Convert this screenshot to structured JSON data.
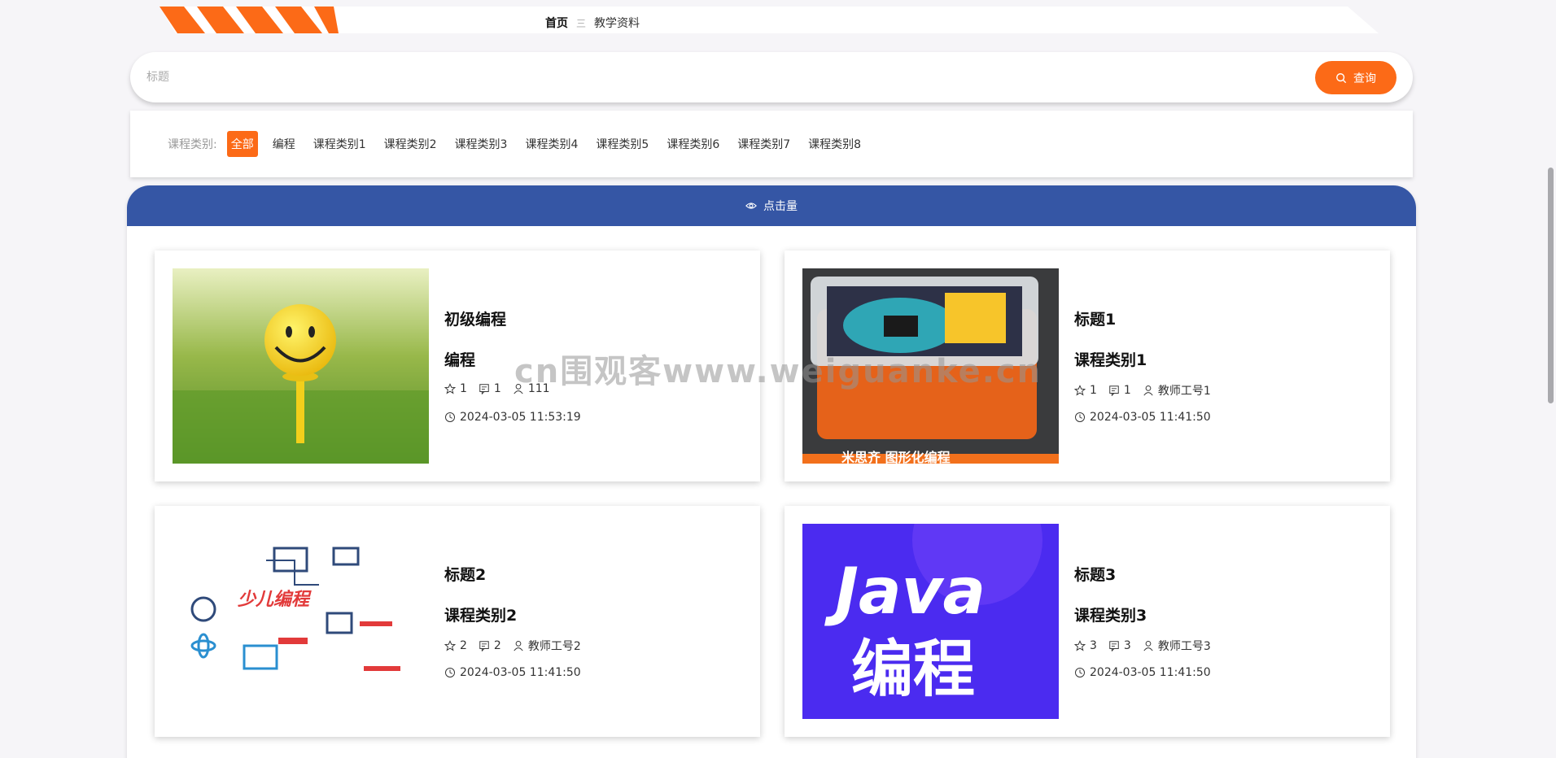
{
  "breadcrumb": {
    "home": "首页",
    "separator": "三",
    "current": "教学资料"
  },
  "search": {
    "placeholder": "标题",
    "button_label": "查询"
  },
  "filter": {
    "label": "课程类别:",
    "items": [
      "全部",
      "编程",
      "课程类别1",
      "课程类别2",
      "课程类别3",
      "课程类别4",
      "课程类别5",
      "课程类别6",
      "课程类别7",
      "课程类别8"
    ],
    "active_index": 0
  },
  "sort": {
    "label": "点击量"
  },
  "cards": [
    {
      "title": "初级编程",
      "category": "编程",
      "likes": "1",
      "comments": "1",
      "teacher": "111",
      "date": "2024-03-05 11:53:19",
      "image": "smiley-golf-ball"
    },
    {
      "title": "标题1",
      "category": "课程类别1",
      "likes": "1",
      "comments": "1",
      "teacher": "教师工号1",
      "date": "2024-03-05 11:41:50",
      "image": "kit-box",
      "image_caption": "米思齐 图形化编程"
    },
    {
      "title": "标题2",
      "category": "课程类别2",
      "likes": "2",
      "comments": "2",
      "teacher": "教师工号2",
      "date": "2024-03-05 11:41:50",
      "image": "kids-coding-icons",
      "image_caption": "少儿编程"
    },
    {
      "title": "标题3",
      "category": "课程类别3",
      "likes": "3",
      "comments": "3",
      "teacher": "教师工号3",
      "date": "2024-03-05 11:41:50",
      "image": "java-programming",
      "image_caption_1": "Java",
      "image_caption_2": "编程"
    }
  ],
  "watermark": "cn围观客www.weiguanke.cn",
  "colors": {
    "accent": "#fc6a17",
    "sort_bar": "#3556a5",
    "background": "#f6f5f8"
  }
}
